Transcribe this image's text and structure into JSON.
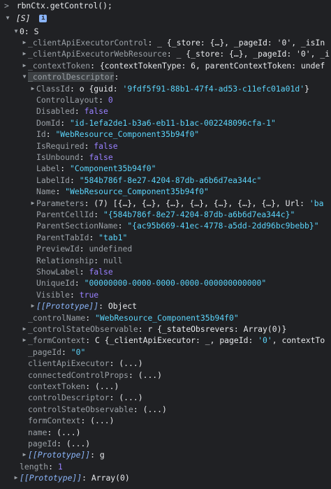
{
  "console": {
    "input_prompt": ">",
    "input_command": "rbnCtx.getControl();",
    "result_open": "[S]",
    "info_badge": "i",
    "lines": [
      {
        "indent": 1,
        "tri": "down",
        "key": "0",
        "sep": ": ",
        "val": [
          {
            "t": "S",
            "c": "w"
          }
        ]
      },
      {
        "indent": 2,
        "tri": "right",
        "key": "_clientApiExecutorControl",
        "sep": ": ",
        "val": [
          {
            "t": "_ {_store: {…}, _pageId: '0', _isIn",
            "c": "w"
          }
        ]
      },
      {
        "indent": 2,
        "tri": "right",
        "key": "_clientApiExecutorWebResource",
        "sep": ": ",
        "val": [
          {
            "t": "_ {_store: {…}, _pageId: '0', _i",
            "c": "w"
          }
        ]
      },
      {
        "indent": 2,
        "tri": "right",
        "key": "_contextToken",
        "sep": ": ",
        "val": [
          {
            "t": "{contextTokenType: 6, parentContextToken: undef",
            "c": "w"
          }
        ]
      },
      {
        "indent": 2,
        "tri": "down",
        "key": "_controlDescriptor",
        "sep": ":",
        "sel": true,
        "val": []
      },
      {
        "indent": 3,
        "tri": "right",
        "key": "ClassId",
        "sep": ": ",
        "val": [
          {
            "t": "o {guid: ",
            "c": "w"
          },
          {
            "t": "'9fdf5f91-88b1-47f4-ad53-c11efc01a01d'",
            "c": "str"
          },
          {
            "t": "}",
            "c": "w"
          }
        ]
      },
      {
        "indent": 3,
        "tri": "",
        "key": "ControlLayout",
        "sep": ": ",
        "val": [
          {
            "t": "0",
            "c": "num"
          }
        ]
      },
      {
        "indent": 3,
        "tri": "",
        "key": "Disabled",
        "sep": ": ",
        "val": [
          {
            "t": "false",
            "c": "bool"
          }
        ]
      },
      {
        "indent": 3,
        "tri": "",
        "key": "DomId",
        "sep": ": ",
        "val": [
          {
            "t": "\"id-1efa2de1-b3a6-eb11-b1ac-002248096cfa-1\"",
            "c": "str"
          }
        ]
      },
      {
        "indent": 3,
        "tri": "",
        "key": "Id",
        "sep": ": ",
        "val": [
          {
            "t": "\"WebResource_Component35b94f0\"",
            "c": "str"
          }
        ]
      },
      {
        "indent": 3,
        "tri": "",
        "key": "IsRequired",
        "sep": ": ",
        "val": [
          {
            "t": "false",
            "c": "bool"
          }
        ]
      },
      {
        "indent": 3,
        "tri": "",
        "key": "IsUnbound",
        "sep": ": ",
        "val": [
          {
            "t": "false",
            "c": "bool"
          }
        ]
      },
      {
        "indent": 3,
        "tri": "",
        "key": "Label",
        "sep": ": ",
        "val": [
          {
            "t": "\"Component35b94f0\"",
            "c": "str"
          }
        ]
      },
      {
        "indent": 3,
        "tri": "",
        "key": "LabelId",
        "sep": ": ",
        "val": [
          {
            "t": "\"584b786f-8e27-4204-87db-a6b6d7ea344c\"",
            "c": "str"
          }
        ]
      },
      {
        "indent": 3,
        "tri": "",
        "key": "Name",
        "sep": ": ",
        "val": [
          {
            "t": "\"WebResource_Component35b94f0\"",
            "c": "str"
          }
        ]
      },
      {
        "indent": 3,
        "tri": "right",
        "key": "Parameters",
        "sep": ": ",
        "val": [
          {
            "t": "(7) [{…}, {…}, {…}, {…}, {…}, {…}, {…}, Url: ",
            "c": "w"
          },
          {
            "t": "'ba",
            "c": "str"
          }
        ]
      },
      {
        "indent": 3,
        "tri": "",
        "key": "ParentCellId",
        "sep": ": ",
        "val": [
          {
            "t": "\"{584b786f-8e27-4204-87db-a6b6d7ea344c}\"",
            "c": "str"
          }
        ]
      },
      {
        "indent": 3,
        "tri": "",
        "key": "ParentSectionName",
        "sep": ": ",
        "val": [
          {
            "t": "\"{ac95b669-41ec-4778-a5dd-2dd96bc9bebb}\"",
            "c": "str"
          }
        ]
      },
      {
        "indent": 3,
        "tri": "",
        "key": "ParentTabId",
        "sep": ": ",
        "val": [
          {
            "t": "\"tab1\"",
            "c": "str"
          }
        ]
      },
      {
        "indent": 3,
        "tri": "",
        "key": "PreviewId",
        "sep": ": ",
        "val": [
          {
            "t": "undefined",
            "c": "undef"
          }
        ]
      },
      {
        "indent": 3,
        "tri": "",
        "key": "Relationship",
        "sep": ": ",
        "val": [
          {
            "t": "null",
            "c": "undef"
          }
        ]
      },
      {
        "indent": 3,
        "tri": "",
        "key": "ShowLabel",
        "sep": ": ",
        "val": [
          {
            "t": "false",
            "c": "bool"
          }
        ]
      },
      {
        "indent": 3,
        "tri": "",
        "key": "UniqueId",
        "sep": ": ",
        "val": [
          {
            "t": "\"00000000-0000-0000-0000-000000000000\"",
            "c": "str"
          }
        ]
      },
      {
        "indent": 3,
        "tri": "",
        "key": "Visible",
        "sep": ": ",
        "val": [
          {
            "t": "true",
            "c": "bool"
          }
        ]
      },
      {
        "indent": 3,
        "tri": "right",
        "key": "[[Prototype]]",
        "sep": ": ",
        "proto": true,
        "val": [
          {
            "t": "Object",
            "c": "w"
          }
        ]
      },
      {
        "indent": 2,
        "tri": "",
        "key": "_controlName",
        "sep": ": ",
        "val": [
          {
            "t": "\"WebResource_Component35b94f0\"",
            "c": "str"
          }
        ]
      },
      {
        "indent": 2,
        "tri": "right",
        "key": "_controlStateObservable",
        "sep": ": ",
        "val": [
          {
            "t": "r {_stateObsrevers: Array(0)}",
            "c": "w"
          }
        ]
      },
      {
        "indent": 2,
        "tri": "right",
        "key": "_formContext",
        "sep": ": ",
        "val": [
          {
            "t": "C {_clientApiExecutor: _, pageId: ",
            "c": "w"
          },
          {
            "t": "'0'",
            "c": "str"
          },
          {
            "t": ", contextTo",
            "c": "w"
          }
        ]
      },
      {
        "indent": 2,
        "tri": "",
        "key": "_pageId",
        "sep": ": ",
        "val": [
          {
            "t": "\"0\"",
            "c": "str"
          }
        ]
      },
      {
        "indent": 2,
        "tri": "",
        "key": "clientApiExecutor",
        "sep": ": ",
        "dim": true,
        "val": [
          {
            "t": "(...)",
            "c": "w"
          }
        ]
      },
      {
        "indent": 2,
        "tri": "",
        "key": "connectedControlProps",
        "sep": ": ",
        "dim": true,
        "val": [
          {
            "t": "(...)",
            "c": "w"
          }
        ]
      },
      {
        "indent": 2,
        "tri": "",
        "key": "contextToken",
        "sep": ": ",
        "dim": true,
        "val": [
          {
            "t": "(...)",
            "c": "w"
          }
        ]
      },
      {
        "indent": 2,
        "tri": "",
        "key": "controlDescriptor",
        "sep": ": ",
        "dim": true,
        "val": [
          {
            "t": "(...)",
            "c": "w"
          }
        ]
      },
      {
        "indent": 2,
        "tri": "",
        "key": "controlStateObservable",
        "sep": ": ",
        "dim": true,
        "val": [
          {
            "t": "(...)",
            "c": "w"
          }
        ]
      },
      {
        "indent": 2,
        "tri": "",
        "key": "formContext",
        "sep": ": ",
        "dim": true,
        "val": [
          {
            "t": "(...)",
            "c": "w"
          }
        ]
      },
      {
        "indent": 2,
        "tri": "",
        "key": "name",
        "sep": ": ",
        "dim": true,
        "val": [
          {
            "t": "(...)",
            "c": "w"
          }
        ]
      },
      {
        "indent": 2,
        "tri": "",
        "key": "pageId",
        "sep": ": ",
        "dim": true,
        "val": [
          {
            "t": "(...)",
            "c": "w"
          }
        ]
      },
      {
        "indent": 2,
        "tri": "right",
        "key": "[[Prototype]]",
        "sep": ": ",
        "proto": true,
        "val": [
          {
            "t": "g",
            "c": "w"
          }
        ]
      },
      {
        "indent": 1,
        "tri": "",
        "key": "length",
        "sep": ": ",
        "val": [
          {
            "t": "1",
            "c": "num"
          }
        ]
      },
      {
        "indent": 1,
        "tri": "right",
        "key": "[[Prototype]]",
        "sep": ": ",
        "proto": true,
        "val": [
          {
            "t": "Array(0)",
            "c": "w"
          }
        ]
      }
    ]
  },
  "colors": {
    "background": "#202124",
    "key": "#9aa0a6",
    "string": "#5cd5fb",
    "number": "#9980ff",
    "prototype": "#8ab4f8",
    "selection": "#3c4043"
  }
}
